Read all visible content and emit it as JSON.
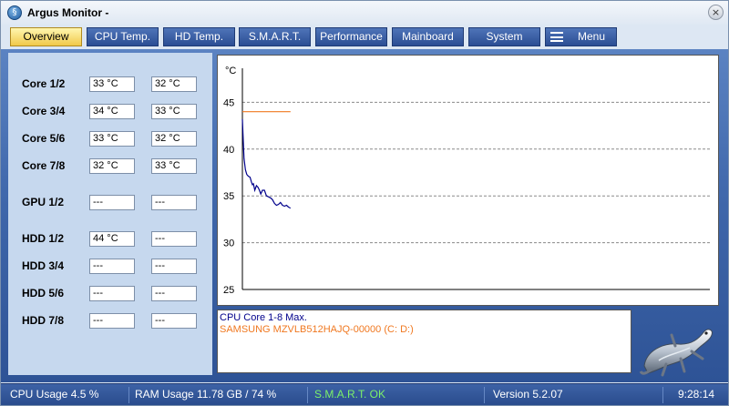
{
  "window": {
    "title": "Argus Monitor -",
    "close_glyph": "×",
    "app_icon_glyph": "§"
  },
  "tabs": [
    {
      "label": "Overview",
      "active": true
    },
    {
      "label": "CPU Temp."
    },
    {
      "label": "HD Temp."
    },
    {
      "label": "S.M.A.R.T."
    },
    {
      "label": "Performance"
    },
    {
      "label": "Mainboard"
    },
    {
      "label": "System"
    },
    {
      "label": "Menu",
      "icon": "hamburger-icon"
    }
  ],
  "sensors": [
    {
      "label": "Core 1/2",
      "v1": "33 °C",
      "v2": "32 °C"
    },
    {
      "label": "Core 3/4",
      "v1": "34 °C",
      "v2": "33 °C"
    },
    {
      "label": "Core 5/6",
      "v1": "33 °C",
      "v2": "32 °C"
    },
    {
      "label": "Core 7/8",
      "v1": "32 °C",
      "v2": "33 °C"
    },
    {
      "label": "GPU 1/2",
      "v1": "---",
      "v2": "---"
    },
    {
      "label": "HDD 1/2",
      "v1": "44 °C",
      "v2": "---"
    },
    {
      "label": "HDD 3/4",
      "v1": "---",
      "v2": "---"
    },
    {
      "label": "HDD 5/6",
      "v1": "---",
      "v2": "---"
    },
    {
      "label": "HDD 7/8",
      "v1": "---",
      "v2": "---"
    }
  ],
  "graph": {
    "unit": "°C",
    "y_ticks": [
      "45",
      "40",
      "35",
      "30",
      "25"
    ],
    "ylim": [
      25,
      50
    ]
  },
  "chart_data": {
    "type": "line",
    "ylabel": "°C",
    "ylim": [
      25,
      50
    ],
    "grid": true,
    "series": [
      {
        "name": "CPU Core 1-8 Max.",
        "color": "#00008b",
        "x": [
          0,
          0.3,
          0.8,
          1.5,
          2.2,
          3,
          3.8,
          4.5,
          5,
          5.5,
          6.2,
          7,
          7.8,
          8.5,
          9.2,
          10,
          11,
          12,
          13,
          14,
          15,
          16,
          17,
          18,
          19,
          20,
          21,
          22,
          23,
          24
        ],
        "values": [
          43.2,
          41.5,
          39,
          37.8,
          37.3,
          37.1,
          37,
          36.5,
          36.2,
          36.3,
          35.6,
          36.1,
          35.9,
          35.6,
          35.2,
          35.6,
          35.6,
          35.0,
          34.9,
          34.8,
          34.6,
          34.2,
          34.0,
          34.1,
          34.3,
          34.0,
          33.9,
          34.0,
          33.8,
          33.7
        ]
      },
      {
        "name": "SAMSUNG MZVLB512HAJQ-00000 (C: D:)",
        "color": "#f07820",
        "x": [
          0,
          24
        ],
        "values": [
          44,
          44
        ]
      }
    ]
  },
  "statusbar": {
    "cpu": "CPU Usage 4.5 %",
    "ram": "RAM Usage 11.78 GB / 74 %",
    "smart": "S.M.A.R.T. OK",
    "version": "Version 5.2.07",
    "time": "9:28:14",
    "smart_color": "#7cf06a"
  }
}
